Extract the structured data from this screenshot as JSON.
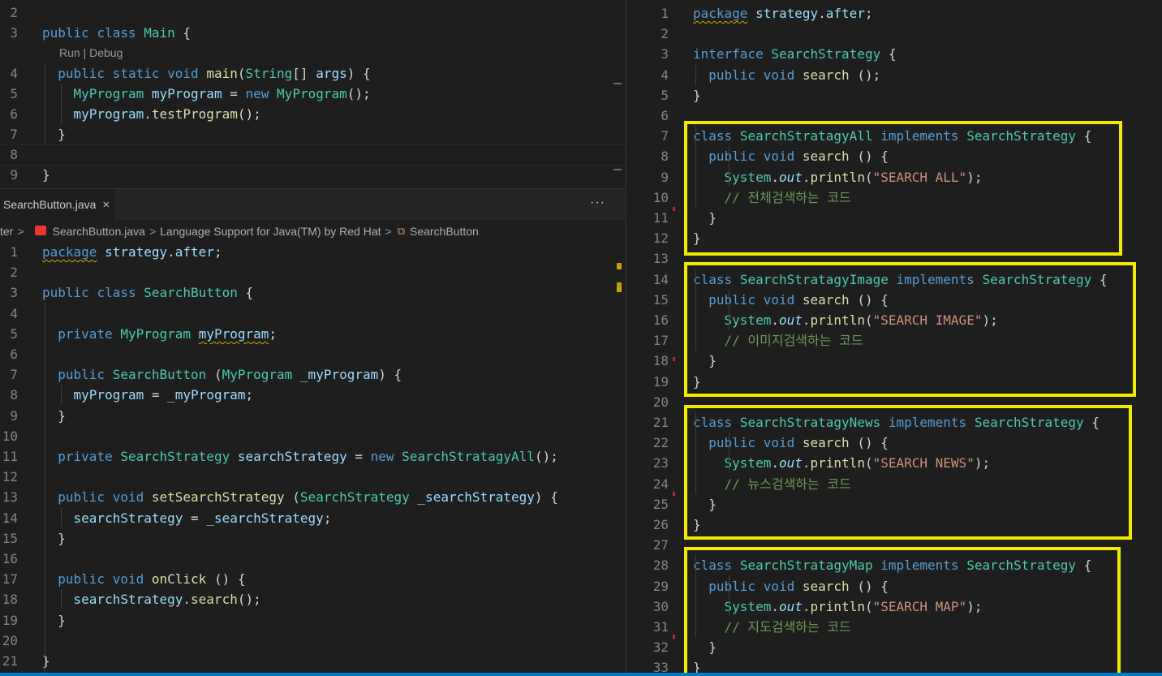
{
  "top_editor": {
    "codelens": "Run | Debug",
    "lines": [
      {
        "n": "2",
        "code": ""
      },
      {
        "n": "3",
        "code": "public class Main {"
      },
      {
        "n": "4",
        "code": "  public static void main(String[] args) {"
      },
      {
        "n": "5",
        "code": "    MyProgram myProgram = new MyProgram();"
      },
      {
        "n": "6",
        "code": "    myProgram.testProgram();"
      },
      {
        "n": "7",
        "code": "  }"
      },
      {
        "n": "8",
        "code": ""
      },
      {
        "n": "9",
        "code": "}"
      }
    ]
  },
  "tab": {
    "label": "SearchButton.java",
    "close": "×",
    "more": "···"
  },
  "breadcrumb": {
    "parts": [
      "ter",
      "SearchButton.java",
      "Language Support for Java(TM) by Red Hat",
      "SearchButton"
    ],
    "separator": ">"
  },
  "left_editor": {
    "lines": [
      {
        "n": "1",
        "code": "package strategy.after;"
      },
      {
        "n": "2",
        "code": ""
      },
      {
        "n": "3",
        "code": "public class SearchButton {"
      },
      {
        "n": "4",
        "code": ""
      },
      {
        "n": "5",
        "code": "  private MyProgram myProgram;"
      },
      {
        "n": "6",
        "code": ""
      },
      {
        "n": "7",
        "code": "  public SearchButton (MyProgram _myProgram) {"
      },
      {
        "n": "8",
        "code": "    myProgram = _myProgram;"
      },
      {
        "n": "9",
        "code": "  }"
      },
      {
        "n": "10",
        "code": ""
      },
      {
        "n": "11",
        "code": "  private SearchStrategy searchStrategy = new SearchStratagyAll();"
      },
      {
        "n": "12",
        "code": ""
      },
      {
        "n": "13",
        "code": "  public void setSearchStrategy (SearchStrategy _searchStrategy) {"
      },
      {
        "n": "14",
        "code": "    searchStrategy = _searchStrategy;"
      },
      {
        "n": "15",
        "code": "  }"
      },
      {
        "n": "16",
        "code": ""
      },
      {
        "n": "17",
        "code": "  public void onClick () {"
      },
      {
        "n": "18",
        "code": "    searchStrategy.search();"
      },
      {
        "n": "19",
        "code": "  }"
      },
      {
        "n": "20",
        "code": ""
      },
      {
        "n": "21",
        "code": "}"
      }
    ]
  },
  "right_editor": {
    "lines": [
      {
        "n": "1",
        "code": "package strategy.after;"
      },
      {
        "n": "2",
        "code": ""
      },
      {
        "n": "3",
        "code": "interface SearchStrategy {"
      },
      {
        "n": "4",
        "code": "  public void search ();"
      },
      {
        "n": "5",
        "code": "}"
      },
      {
        "n": "6",
        "code": ""
      },
      {
        "n": "7",
        "code": "class SearchStratagyAll implements SearchStrategy {"
      },
      {
        "n": "8",
        "code": "  public void search () {"
      },
      {
        "n": "9",
        "code": "    System.out.println(\"SEARCH ALL\");"
      },
      {
        "n": "10",
        "code": "    // 전체검색하는 코드"
      },
      {
        "n": "11",
        "code": "  }"
      },
      {
        "n": "12",
        "code": "}"
      },
      {
        "n": "13",
        "code": ""
      },
      {
        "n": "14",
        "code": "class SearchStratagyImage implements SearchStrategy {"
      },
      {
        "n": "15",
        "code": "  public void search () {"
      },
      {
        "n": "16",
        "code": "    System.out.println(\"SEARCH IMAGE\");"
      },
      {
        "n": "17",
        "code": "    // 이미지검색하는 코드"
      },
      {
        "n": "18",
        "code": "  }"
      },
      {
        "n": "19",
        "code": "}"
      },
      {
        "n": "20",
        "code": ""
      },
      {
        "n": "21",
        "code": "class SearchStratagyNews implements SearchStrategy {"
      },
      {
        "n": "22",
        "code": "  public void search () {"
      },
      {
        "n": "23",
        "code": "    System.out.println(\"SEARCH NEWS\");"
      },
      {
        "n": "24",
        "code": "    // 뉴스검색하는 코드"
      },
      {
        "n": "25",
        "code": "  }"
      },
      {
        "n": "26",
        "code": "}"
      },
      {
        "n": "27",
        "code": ""
      },
      {
        "n": "28",
        "code": "class SearchStratagyMap implements SearchStrategy {"
      },
      {
        "n": "29",
        "code": "  public void search () {"
      },
      {
        "n": "30",
        "code": "    System.out.println(\"SEARCH MAP\");"
      },
      {
        "n": "31",
        "code": "    // 지도검색하는 코드"
      },
      {
        "n": "32",
        "code": "  }"
      },
      {
        "n": "33",
        "code": "}"
      }
    ]
  },
  "colors": {
    "highlight_box": "#f0ea00",
    "keyword": "#569cd6",
    "type": "#4ec9b0",
    "string": "#ce9178",
    "comment": "#6a9955"
  }
}
